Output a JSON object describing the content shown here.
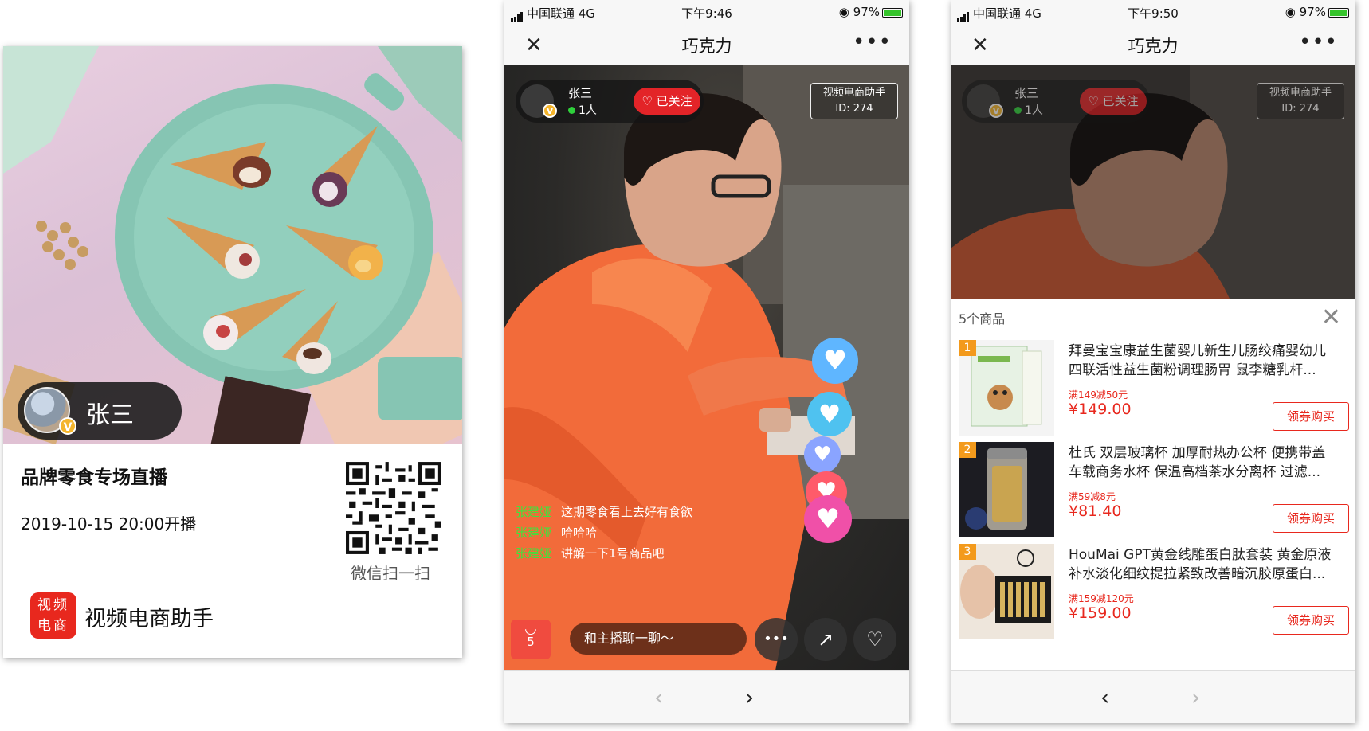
{
  "poster": {
    "name": "张三",
    "verified_badge": "V",
    "title": "品牌零食专场直播",
    "date": "2019-10-15 20:00开播",
    "qr_caption": "微信扫一扫",
    "logo_line1": "视频",
    "logo_line2": "电商",
    "logo_text": "视频电商助手"
  },
  "phone_live": {
    "status": {
      "carrier": "中国联通 4G",
      "time": "下午9:46",
      "battery": "97%"
    },
    "nav": {
      "close": "✕",
      "title": "巧克力",
      "more": "•••"
    },
    "host": {
      "name": "张三",
      "badge": "V",
      "viewers": "1人",
      "follow": "已关注"
    },
    "room": {
      "label": "视频电商助手",
      "id": "ID:  274"
    },
    "comments": [
      {
        "name": "张建娅",
        "text": "这期零食看上去好有食欲"
      },
      {
        "name": "张建娅",
        "text": "哈哈哈"
      },
      {
        "name": "张建娅",
        "text": "讲解一下1号商品吧"
      }
    ],
    "bag_count": "5",
    "chat_placeholder": "和主播聊一聊～",
    "more_btn": "•••",
    "share_icon": "share-icon",
    "like_icon": "heart-icon",
    "nav_back": "‹",
    "nav_forward": "›"
  },
  "phone_products": {
    "status": {
      "carrier": "中国联通 4G",
      "time": "下午9:50",
      "battery": "97%"
    },
    "nav": {
      "close": "✕",
      "title": "巧克力",
      "more": "•••"
    },
    "host": {
      "name": "张三",
      "badge": "V",
      "viewers": "1人",
      "follow": "已关注"
    },
    "room": {
      "label": "视频电商助手",
      "id": "ID:  274"
    },
    "panel_count": "5个商品",
    "panel_close": "✕",
    "products": [
      {
        "rank": "1",
        "title": "拜曼宝宝康益生菌婴儿新生儿肠绞痛婴幼儿四联活性益生菌粉调理肠胃 鼠李糖乳杆...",
        "coupon": "满149减50元",
        "price": "¥149.00",
        "button": "领券购买"
      },
      {
        "rank": "2",
        "title": "杜氏 双层玻璃杯 加厚耐热办公杯 便携带盖车载商务水杯 保温高档茶水分离杯 过滤...",
        "coupon": "满59减8元",
        "price": "¥81.40",
        "button": "领券购买"
      },
      {
        "rank": "3",
        "title": "HouMai GPT黄金线雕蛋白肽套装 黄金原液补水淡化细纹提拉紧致改善暗沉胶原蛋白...",
        "coupon": "满159减120元",
        "price": "¥159.00",
        "button": "领券购买"
      }
    ],
    "nav_back": "‹",
    "nav_forward": "›"
  },
  "colors": {
    "accent_red": "#e32428",
    "price_red": "#e8281e",
    "online_green": "#2ed13b",
    "comment_name_green": "#3ce63c"
  }
}
